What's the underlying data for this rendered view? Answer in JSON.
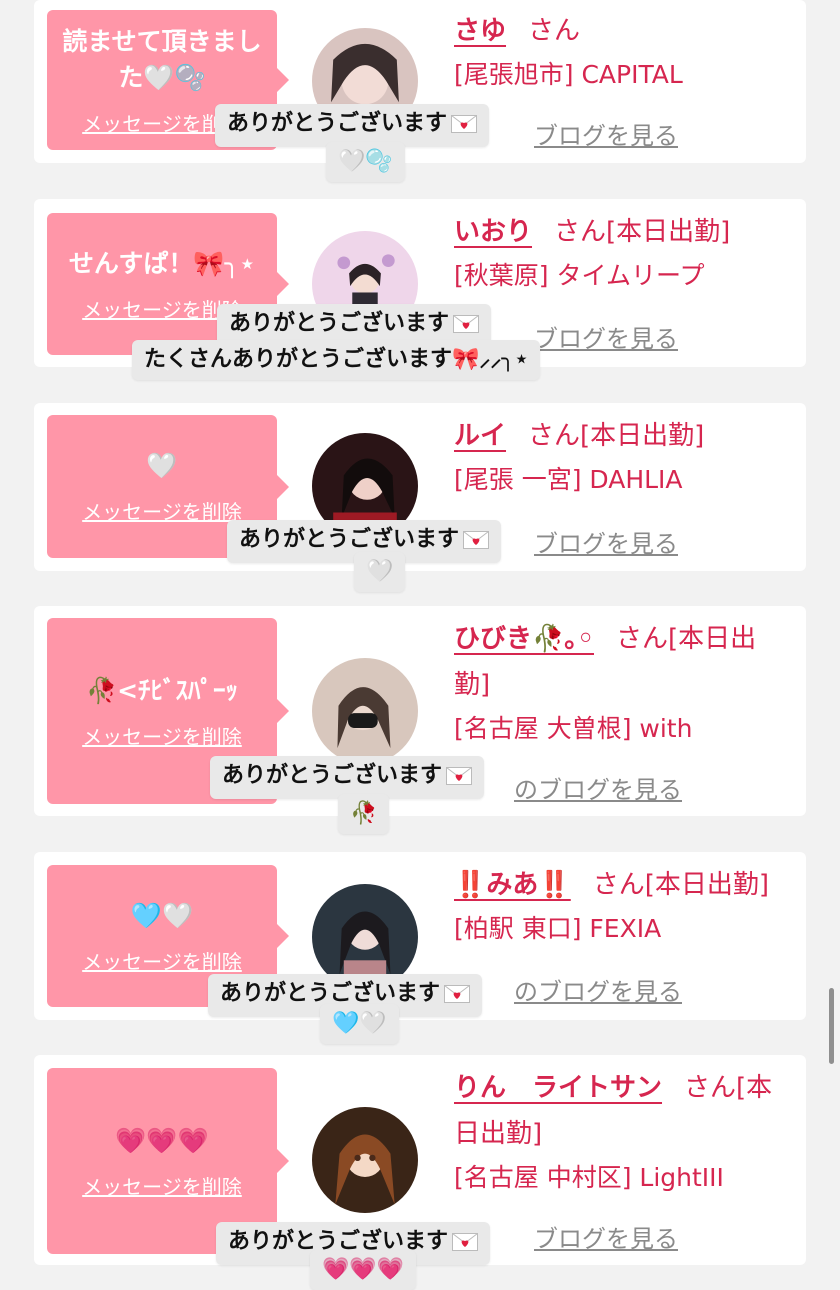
{
  "delete_label": "メッセージを削除",
  "blog_label": "ブログを見る",
  "blog_label_partial": "ブログを見る",
  "blog_label_partial2": "のブログを見る",
  "thanks_label": "ありがとうございます",
  "icons": [
    "envelope-heart-icon",
    "white-heart-icon",
    "bubbles-icon",
    "ribbon-icon",
    "rose-icon",
    "blue-heart-icon",
    "pink-heart-icon"
  ],
  "colors": {
    "bubble": "#ff96a8",
    "name": "#d6264f",
    "link_gray": "#8a8a8a",
    "chip": "#e9e9e9"
  },
  "cards": [
    {
      "bubble_message": "読ませて頂きました🤍🫧",
      "name": "さゆ",
      "san": "さん",
      "shop": "[尾張旭市] CAPITAL",
      "chip_sub": "🤍🫧"
    },
    {
      "bubble_message": "せんすぱ！🎀╮⋆",
      "name": "いおり",
      "san": "さん[本日出勤]",
      "shop": "[秋葉原] タイムリープ",
      "chip_sub": "たくさんありがとうございます🎀⸝⸝╮⋆"
    },
    {
      "bubble_message": "🤍",
      "name": "ルイ",
      "san": "さん[本日出勤]",
      "shop": "[尾張 一宮] DAHLIA",
      "chip_sub": "🤍"
    },
    {
      "bubble_message": "🥀<ﾁﾋﾞｽﾊﾟｰｯ",
      "name": "ひびき🥀｡◦",
      "san": "さん[本日出勤]",
      "shop": "[名古屋 大曽根] with",
      "chip_sub": "🥀"
    },
    {
      "bubble_message": "🩵🤍",
      "name": "‼️みあ‼️",
      "san": "さん[本日出勤]",
      "shop": "[柏駅 東口] FEXIA",
      "chip_sub": "🩵🤍"
    },
    {
      "bubble_message": "💗💗💗",
      "name": "りん　ライトサン",
      "san": "さん[本日出勤]",
      "shop": "[名古屋 中村区] LightIII",
      "chip_sub": "💗💗💗"
    }
  ]
}
